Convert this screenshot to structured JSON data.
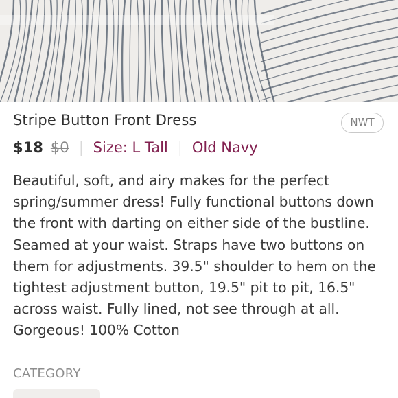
{
  "listing": {
    "title": "Stripe Button Front Dress",
    "condition_badge": "NWT",
    "price": "$18",
    "original_price": "$0",
    "separator": "|",
    "size": "Size: L Tall",
    "brand": "Old Navy",
    "description": "Beautiful, soft, and airy makes for the perfect spring/summer dress! Fully functional buttons down the front with darting on either side of the bustline. Seamed at your waist. Straps have two buttons on them for adjustments. 39.5\" shoulder to hem on the tightest adjustment button, 19.5\" pit to pit, 16.5\" across waist. Fully lined, not see through at all. Gorgeous! 100% Cotton",
    "category_heading": "CATEGORY"
  },
  "colors": {
    "title_text": "#2f2f2f",
    "accent": "#822150",
    "muted": "#8e8e8e",
    "stripe": "#4a5566",
    "fabric": "#efedea"
  },
  "photo": {
    "subject": "white fabric with dark blue vertical stripes"
  }
}
